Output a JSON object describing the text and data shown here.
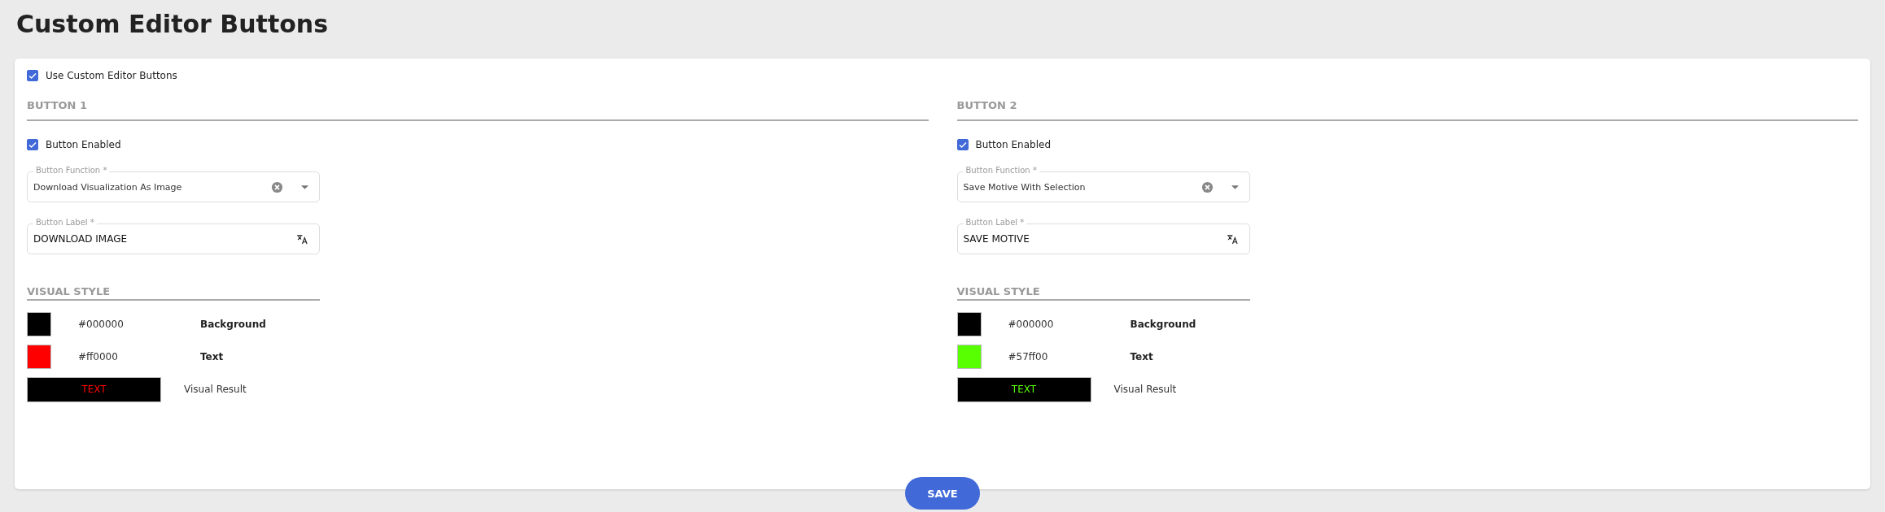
{
  "page": {
    "title": "Custom Editor Buttons"
  },
  "use_custom": {
    "label": "Use Custom Editor Buttons",
    "checked": true
  },
  "buttons": [
    {
      "heading": "BUTTON 1",
      "enabled": {
        "label": "Button Enabled",
        "checked": true
      },
      "function_field": {
        "label": "Button Function *",
        "value": "Download Visualization As Image"
      },
      "label_field": {
        "label": "Button Label *",
        "value": "DOWNLOAD IMAGE"
      },
      "style_heading": "VISUAL STYLE",
      "styles": [
        {
          "color": "#000000",
          "value": "#000000",
          "label": "Background"
        },
        {
          "color": "#ff0000",
          "value": "#ff0000",
          "label": "Text"
        }
      ],
      "result": {
        "text": "TEXT",
        "label": "Visual Result"
      }
    },
    {
      "heading": "BUTTON 2",
      "enabled": {
        "label": "Button Enabled",
        "checked": true
      },
      "function_field": {
        "label": "Button Function *",
        "value": "Save Motive With Selection"
      },
      "label_field": {
        "label": "Button Label *",
        "value": "SAVE MOTIVE"
      },
      "style_heading": "VISUAL STYLE",
      "styles": [
        {
          "color": "#000000",
          "value": "#000000",
          "label": "Background"
        },
        {
          "color": "#57ff00",
          "value": "#57ff00",
          "label": "Text"
        }
      ],
      "result": {
        "text": "TEXT",
        "label": "Visual Result"
      }
    }
  ],
  "save_button": "SAVE"
}
